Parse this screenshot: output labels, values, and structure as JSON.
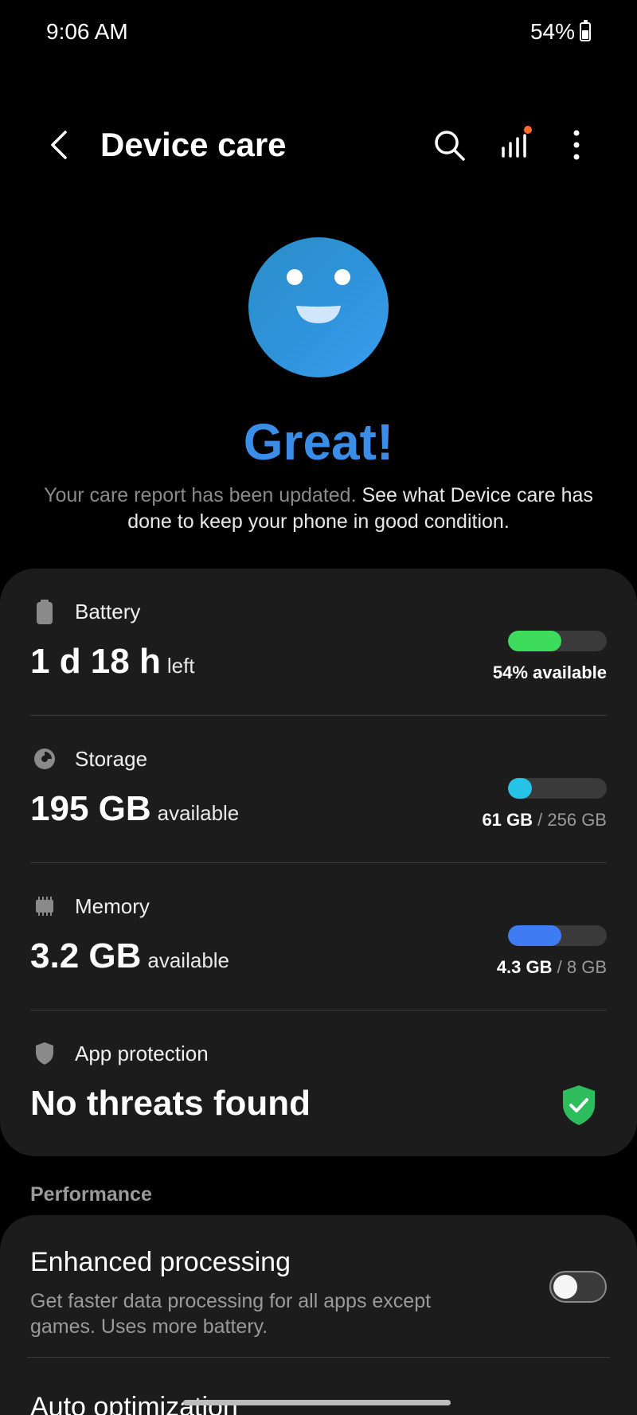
{
  "status_bar": {
    "time": "9:06 AM",
    "battery": "54%",
    "battery_level_fraction": 0.54
  },
  "app_bar": {
    "title": "Device care",
    "icons": [
      "back-icon",
      "search-icon",
      "signal-bars-icon",
      "more-vertical-icon"
    ],
    "notification_dot_color": "#ff6a2b"
  },
  "hero": {
    "title": "Great!",
    "desc_muted": "Your care report has been updated.",
    "desc_link": "See what Device care has done to keep your phone in good condition."
  },
  "battery": {
    "label": "Battery",
    "value": "1 d 18 h",
    "unit": "left",
    "caption": "54% available",
    "level_fraction": 0.54,
    "color": "#3ddc5c"
  },
  "storage": {
    "label": "Storage",
    "value": "195 GB",
    "unit": "available",
    "used": "61 GB",
    "total": "/ 256 GB",
    "level_fraction": 0.24,
    "color": "#27c3e6"
  },
  "memory": {
    "label": "Memory",
    "value": "3.2 GB",
    "unit": "available",
    "used": "4.3 GB",
    "total": "/ 8 GB",
    "level_fraction": 0.54,
    "color": "#3f7bf2"
  },
  "app_protection": {
    "label": "App protection",
    "value": "No threats found",
    "status_color": "#2dbd5c"
  },
  "performance": {
    "section_title": "Performance",
    "enhanced_title": "Enhanced processing",
    "enhanced_desc": "Get faster data processing for all apps except games. Uses more battery.",
    "enhanced_on": false,
    "auto_title": "Auto optimization"
  }
}
